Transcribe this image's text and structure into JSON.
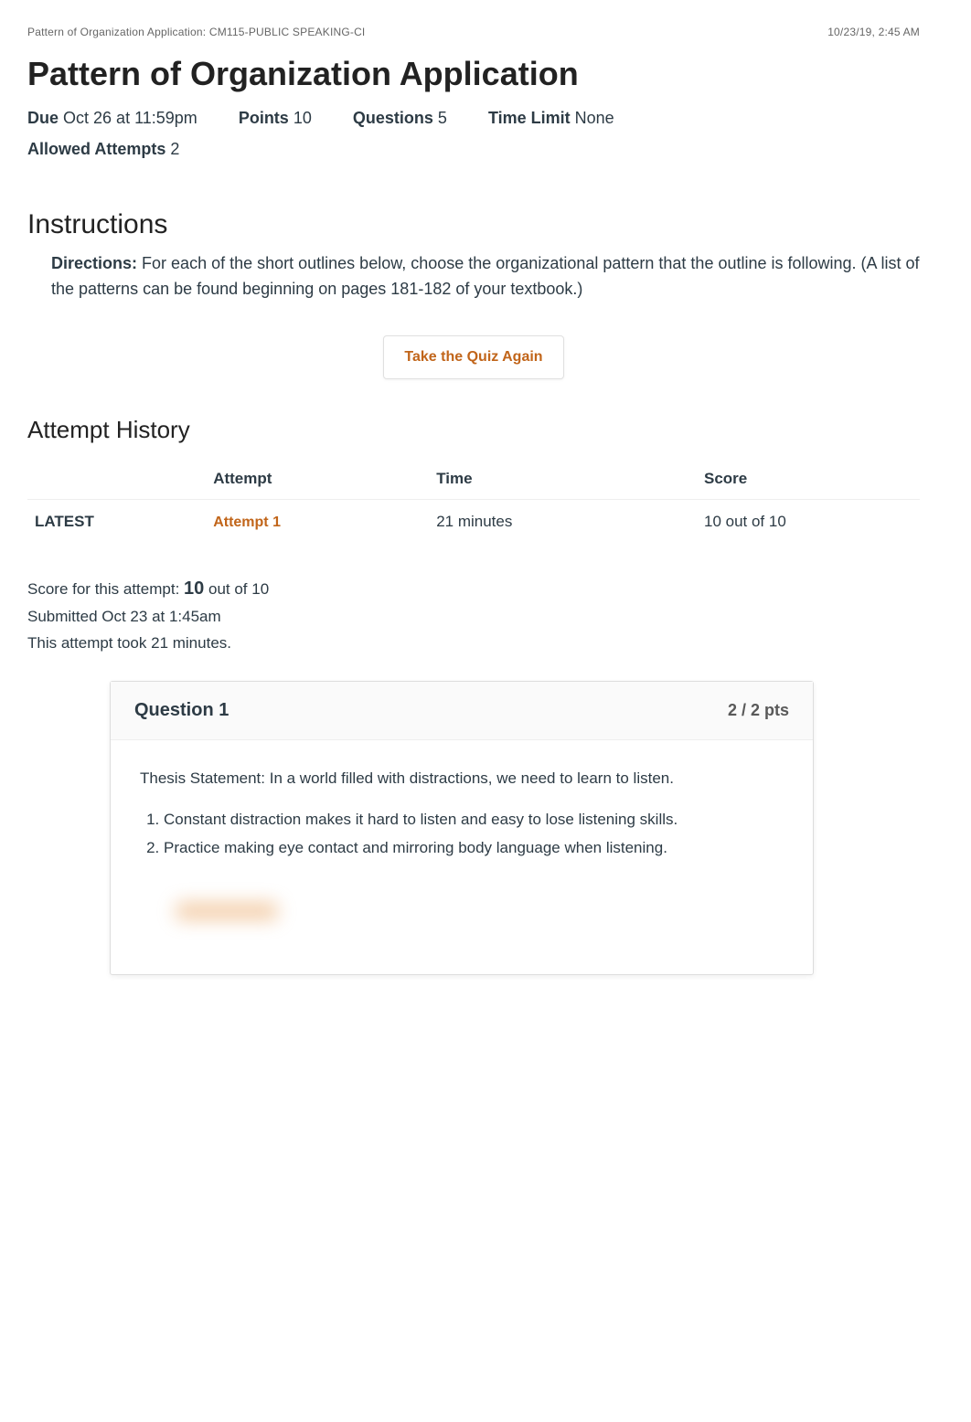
{
  "header": {
    "left": "Pattern of Organization Application: CM115-PUBLIC SPEAKING-CI",
    "right": "10/23/19, 2:45 AM"
  },
  "title": "Pattern of Organization Application",
  "meta": {
    "due_label": "Due",
    "due_value": "Oct 26 at 11:59pm",
    "points_label": "Points",
    "points_value": "10",
    "questions_label": "Questions",
    "questions_value": "5",
    "timelimit_label": "Time Limit",
    "timelimit_value": "None",
    "attempts_label": "Allowed Attempts",
    "attempts_value": "2"
  },
  "instructions": {
    "heading": "Instructions",
    "label": "Directions:",
    "text": "For each of the short outlines below, choose the organizational pattern that the outline is following. (A list of the patterns can be found beginning on pages 181-182 of your textbook.)"
  },
  "take_again": "Take the Quiz Again",
  "attempt_history": {
    "heading": "Attempt History",
    "columns": {
      "c0": "",
      "c1": "Attempt",
      "c2": "Time",
      "c3": "Score"
    },
    "rows": [
      {
        "latest": "LATEST",
        "attempt": "Attempt 1",
        "time": "21 minutes",
        "score": "10 out of 10"
      }
    ]
  },
  "score_block": {
    "line1_pre": "Score for this attempt: ",
    "line1_big": "10",
    "line1_post": " out of 10",
    "line2": "Submitted Oct 23 at 1:45am",
    "line3": "This attempt took 21 minutes."
  },
  "question1": {
    "title": "Question 1",
    "pts": "2 / 2 pts",
    "thesis": "Thesis Statement: In a world filled with distractions, we need to learn to listen.",
    "li1": "Constant distraction makes it hard to listen and easy to lose listening skills.",
    "li2": "Practice making eye contact and mirroring body language when listening."
  }
}
